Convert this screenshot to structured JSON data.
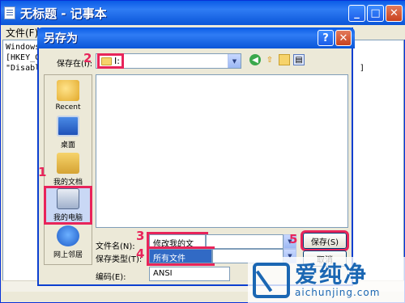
{
  "notepad": {
    "title": "无标题 - 记事本",
    "menu": [
      "文件(F)"
    ],
    "lines": [
      "Windows",
      "",
      "[HKEY_C",
      "\"Disabl"
    ],
    "right_bracket": "]"
  },
  "dialog": {
    "title": "另存为",
    "help_button": "?",
    "close_button": "✕",
    "save_in_label": "保存在(I):",
    "save_in_value": "I:",
    "places": [
      {
        "label": "Recent",
        "icon": "recent-icon"
      },
      {
        "label": "桌面",
        "icon": "desktop-icon"
      },
      {
        "label": "我的文档",
        "icon": "my-documents-icon"
      },
      {
        "label": "我的电脑",
        "icon": "my-computer-icon"
      },
      {
        "label": "网上邻居",
        "icon": "network-places-icon"
      }
    ],
    "filename_label": "文件名(N):",
    "filename_value": "修改我的文档.reg",
    "filetype_label": "保存类型(T):",
    "filetype_value": "所有文件",
    "encoding_label": "编码(E):",
    "encoding_value": "ANSI",
    "save_button": "保存(S)",
    "cancel_button": "取消"
  },
  "annotations": [
    "1",
    "2",
    "3",
    "4",
    "5"
  ],
  "watermark": {
    "cn": "爱纯净",
    "en": "aichunjing.com",
    "accent": "#1b67b3"
  },
  "colors": {
    "highlight": "#e8245a",
    "titlebar": "#0a5be6"
  }
}
